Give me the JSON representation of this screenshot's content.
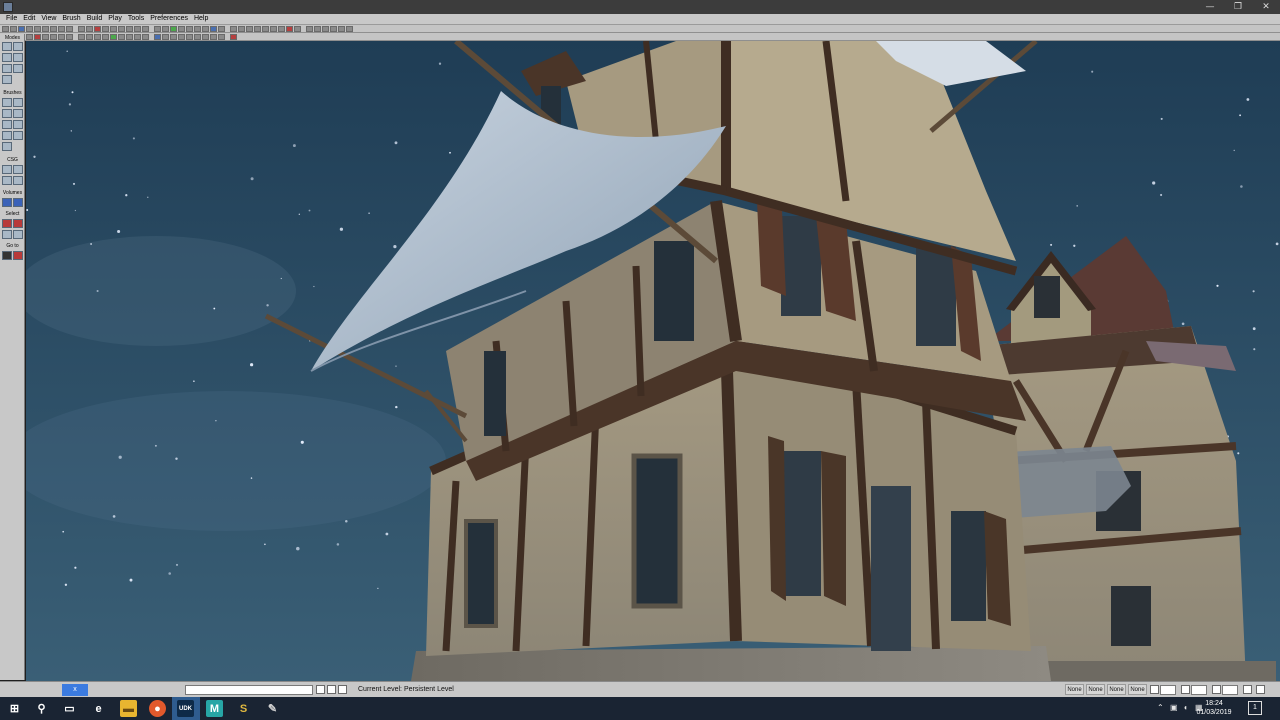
{
  "titlebar": {
    "controls": {
      "minimize": "—",
      "maximize": "❐",
      "close": "✕"
    }
  },
  "menu": [
    "File",
    "Edit",
    "View",
    "Brush",
    "Build",
    "Play",
    "Tools",
    "Preferences",
    "Help"
  ],
  "palette": {
    "sections": [
      "Modes",
      "Brushes",
      "CSG",
      "Volumes",
      "Select",
      "Go to"
    ]
  },
  "status": {
    "tabs": [
      "",
      "x"
    ],
    "current_level_label": "Current Level:",
    "current_level_value": "Persistent Level",
    "snap_labels": [
      "None",
      "None",
      "None",
      "None"
    ]
  },
  "taskbar": {
    "apps": [
      {
        "name": "windows-start",
        "glyph": "⊞",
        "color": "#1a2433"
      },
      {
        "name": "search",
        "glyph": "⚲",
        "color": "#1a2433"
      },
      {
        "name": "task-view",
        "glyph": "▭",
        "color": "#1a2433"
      },
      {
        "name": "edge",
        "glyph": "e",
        "color": "#1a2433"
      },
      {
        "name": "file-explorer",
        "glyph": "▬",
        "color": "#e8b530"
      },
      {
        "name": "firefox",
        "glyph": "●",
        "color": "#e2592c"
      },
      {
        "name": "unreal-editor",
        "glyph": "UDK",
        "color": "#2f5c8f"
      },
      {
        "name": "maya",
        "glyph": "M",
        "color": "#27a6a6"
      },
      {
        "name": "3dsmax",
        "glyph": "S",
        "color": "#1a2433"
      },
      {
        "name": "app-feather",
        "glyph": "✎",
        "color": "#1a2433"
      }
    ],
    "time": "18:24",
    "date": "01/03/2019",
    "notification_glyph": "1"
  },
  "colors": {
    "sky_top": "#1f3d55",
    "sky_bottom": "#3a5f76",
    "active_tab": "#3b7be0"
  }
}
